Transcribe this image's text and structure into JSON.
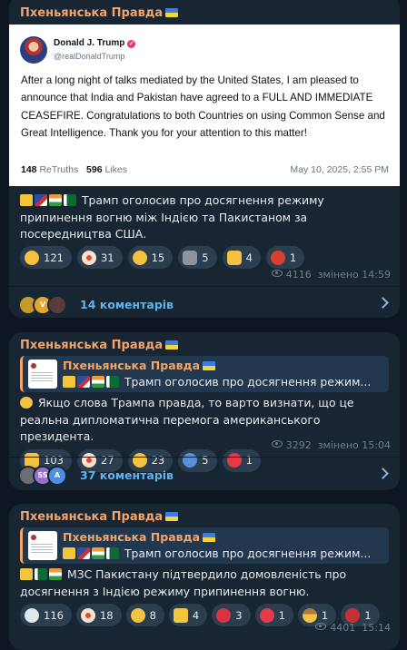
{
  "posts": [
    {
      "channel": "Пхеньянська Правда",
      "tweet": {
        "name": "Donald J. Trump",
        "handle": "@realDonaldTrump",
        "body": "After a long night of talks mediated by the United States, I am pleased to announce that India and Pakistan have agreed to a FULL AND IMMEDIATE CEASEFIRE. Congratulations to both Countries on using Common Sense and Great Intelligence. Thank you for your attention to this matter!",
        "retruths_count": "148",
        "retruths_label": "ReTruths",
        "likes_count": "596",
        "likes_label": "Likes",
        "date": "May 10, 2025, 2:55 PM"
      },
      "message": "Трамп оголосив про досягнення режиму припинення вогню між Індією та Пакистаном за посередництва США.",
      "reactions": [
        {
          "icon": "rofl-emoji",
          "count": "121"
        },
        {
          "icon": "clown-emoji",
          "count": "31"
        },
        {
          "icon": "thinking-emoji",
          "count": "15"
        },
        {
          "icon": "moai-emoji",
          "count": "5"
        },
        {
          "icon": "thumbs-up-emoji",
          "count": "4"
        },
        {
          "icon": "angry-emoji",
          "count": "1"
        }
      ],
      "views": "4116",
      "edited": "змінено 14:59",
      "comments": "14 коментарів",
      "commenter_avatars": [
        "",
        "V",
        ""
      ]
    },
    {
      "channel": "Пхеньянська Правда",
      "reply_channel": "Пхеньянська Правда",
      "reply_text": "Трамп оголосив про досягнення режим...",
      "message": "Якщо слова Трампа правда, то варто визнати, що це реальна дипломатична перемога американського президента.",
      "reactions": [
        {
          "icon": "thumbs-up-emoji",
          "count": "103"
        },
        {
          "icon": "clown-emoji",
          "count": "27"
        },
        {
          "icon": "grinning-emoji",
          "count": "23"
        },
        {
          "icon": "shrug-emoji",
          "count": "5"
        },
        {
          "icon": "heart-emoji",
          "count": "1"
        }
      ],
      "views": "3292",
      "edited": "змінено 15:04",
      "comments": "37 коментарів",
      "commenter_avatars": [
        "",
        "SS",
        "A"
      ]
    },
    {
      "channel": "Пхеньянська Правда",
      "reply_channel": "Пхеньянська Правда",
      "reply_text": "Трамп оголосив про досягнення режим...",
      "message": "МЗС Пакистану підтвердило домовленість про досягнення з Індією режиму припинення вогню.",
      "reactions": [
        {
          "icon": "dove-emoji",
          "count": "116"
        },
        {
          "icon": "clown-emoji",
          "count": "18"
        },
        {
          "icon": "grin-emoji",
          "count": "8"
        },
        {
          "icon": "lightning-emoji",
          "count": "4"
        },
        {
          "icon": "broken-heart-emoji",
          "count": "3"
        },
        {
          "icon": "heart-emoji",
          "count": "1"
        },
        {
          "icon": "cowboy-emoji",
          "count": "1"
        },
        {
          "icon": "devil-emoji",
          "count": "1"
        }
      ],
      "views": "4401",
      "time": "15:14"
    }
  ],
  "colors": {
    "background": "#0e1621",
    "bubble": "#182533",
    "channel_name": "#f2a46b",
    "link": "#5fb3f0",
    "reaction_chip": "#2b3e50"
  }
}
